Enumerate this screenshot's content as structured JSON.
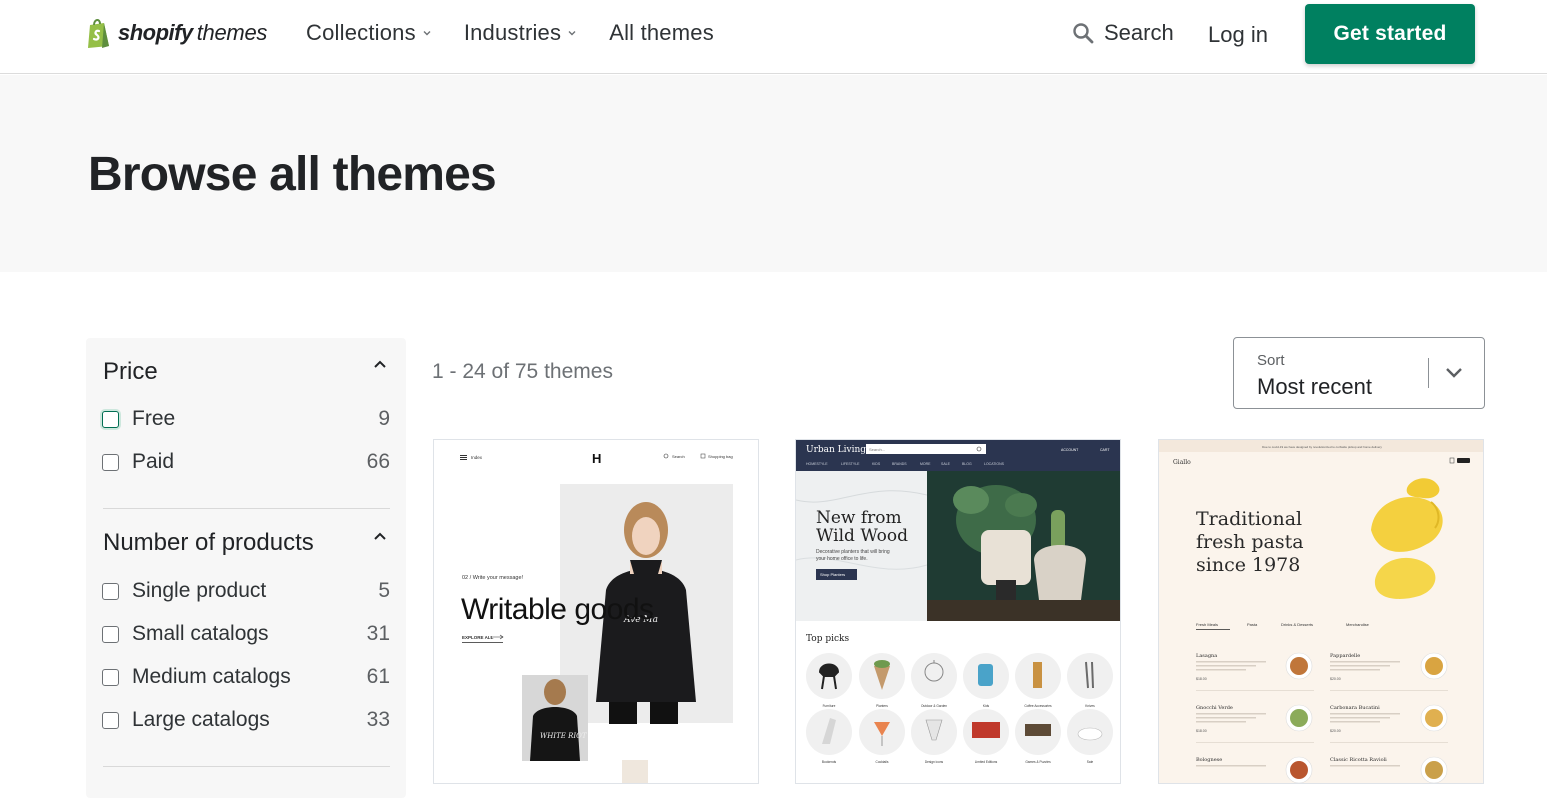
{
  "header": {
    "logo_word": "shopify",
    "logo_sub": "themes",
    "nav": [
      {
        "label": "Collections",
        "has_dropdown": true
      },
      {
        "label": "Industries",
        "has_dropdown": true
      },
      {
        "label": "All themes",
        "has_dropdown": false
      }
    ],
    "search_label": "Search",
    "login_label": "Log in",
    "cta_label": "Get started"
  },
  "hero": {
    "title": "Browse all themes"
  },
  "filters": {
    "price": {
      "title": "Price",
      "options": [
        {
          "label": "Free",
          "count": "9",
          "checked": false
        },
        {
          "label": "Paid",
          "count": "66",
          "checked": false
        }
      ]
    },
    "products": {
      "title": "Number of products",
      "options": [
        {
          "label": "Single product",
          "count": "5",
          "checked": false
        },
        {
          "label": "Small catalogs",
          "count": "31",
          "checked": false
        },
        {
          "label": "Medium catalogs",
          "count": "61",
          "checked": false
        },
        {
          "label": "Large catalogs",
          "count": "33",
          "checked": false
        }
      ]
    }
  },
  "results": {
    "count_text": "1 - 24 of 75 themes",
    "sort_label": "Sort",
    "sort_value": "Most recent"
  },
  "themes": [
    {
      "nav_left": "Index",
      "logo": "H",
      "nav_search": "Search",
      "nav_bag": "Shopping bag",
      "kicker": "02 / Write your message!",
      "headline": "Writable goods",
      "cta": "EXPLORE ALL",
      "shirt_text_1": "Ave Ma",
      "shirt_text_2": "WHITE RIOT"
    },
    {
      "brand": "Urban Living",
      "search_placeholder": "Search...",
      "account": "ACCOUNT",
      "cart": "CART",
      "menu": [
        "HOMESTYLE",
        "LIFESTYLE",
        "KIDS",
        "BRANDS",
        "MORE",
        "SALE",
        "BLOG",
        "LOCATIONS"
      ],
      "headline_1": "New from",
      "headline_2": "Wild Wood",
      "desc_1": "Decorative planters that will bring",
      "desc_2": "your home office to life.",
      "cta": "Shop Planters",
      "section_title": "Top picks",
      "picks": [
        "Furniture",
        "Planters",
        "Outdoor & Garden",
        "Kids",
        "Coffee Accessories",
        "Knives",
        "Bookends",
        "Cocktails",
        "Design icons",
        "Limited Editions",
        "Games & Puzzles",
        "Sale"
      ]
    },
    {
      "banner": "Due to covid-19 we have designed by revolutionized to curbside pickup and home delivery",
      "brand": "Giallo",
      "headline_1": "Traditional",
      "headline_2": "fresh pasta",
      "headline_3": "since 1978",
      "tabs": [
        "Fresh Meals",
        "Pasta",
        "Drinks & Desserts",
        "Merchandise"
      ],
      "items": [
        {
          "name": "Lasagna",
          "price": "$18.00"
        },
        {
          "name": "Pappardelle",
          "price": "$20.00"
        },
        {
          "name": "Gnocchi Verde",
          "price": "$18.00"
        },
        {
          "name": "Carbonara Bucatini",
          "price": "$20.00"
        },
        {
          "name": "Bolognese",
          "price": ""
        },
        {
          "name": "Classic Ricotta Ravioli",
          "price": ""
        }
      ]
    }
  ],
  "colors": {
    "brand_green": "#008060",
    "logo_green": "#95bf47",
    "text": "#212326",
    "hero_bg": "#f8f8f8",
    "urban_nav": "#2b3550"
  }
}
